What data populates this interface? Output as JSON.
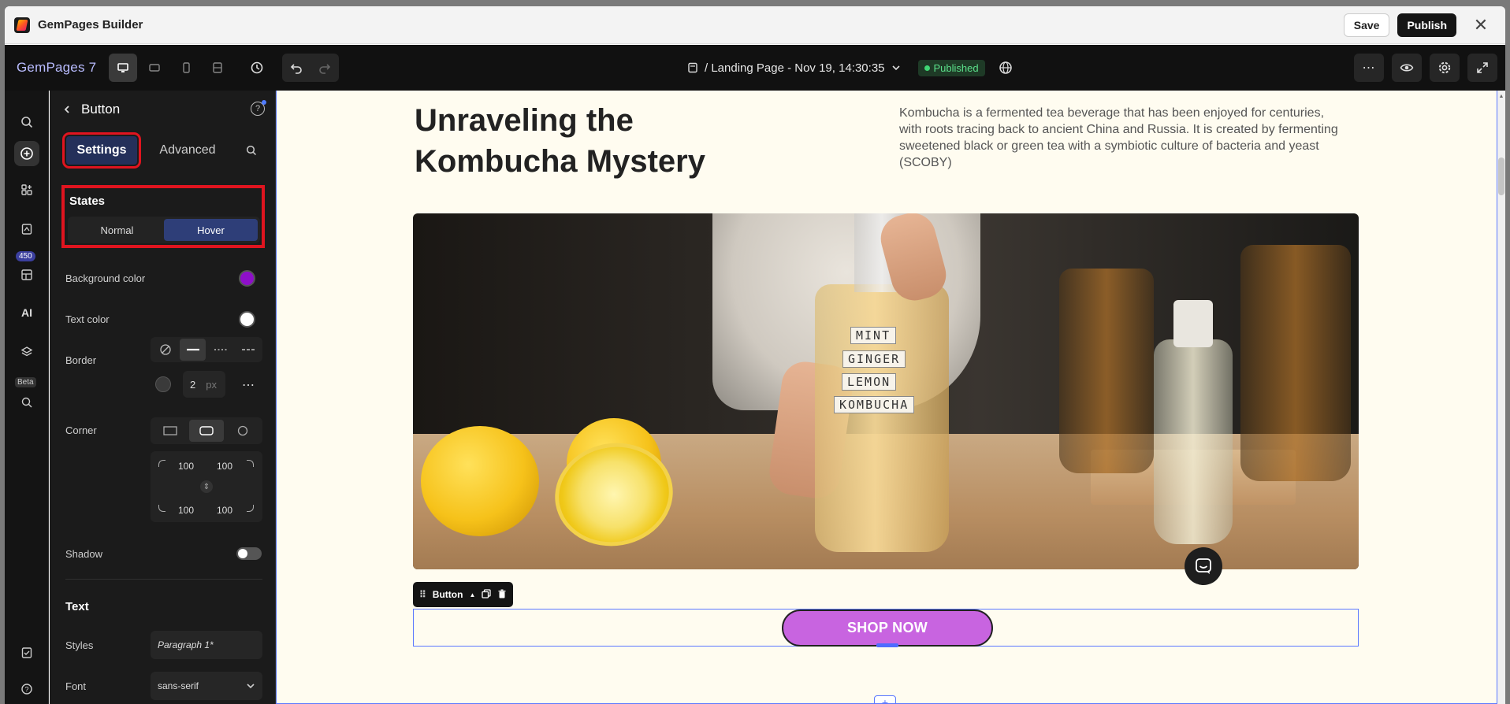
{
  "titlebar": {
    "app_name": "GemPages Builder",
    "save": "Save",
    "publish": "Publish"
  },
  "toolbar": {
    "brand": "GemPages 7",
    "page_name": "/ Landing Page - Nov 19, 14:30:35",
    "status": "Published"
  },
  "rail": {
    "badge": "450",
    "ai_label": "AI",
    "beta": "Beta"
  },
  "panel": {
    "title": "Button",
    "tabs": {
      "settings": "Settings",
      "advanced": "Advanced"
    },
    "states": {
      "title": "States",
      "normal": "Normal",
      "hover": "Hover"
    },
    "background_color_label": "Background color",
    "text_color_label": "Text color",
    "border_label": "Border",
    "border_width": "2",
    "border_unit": "px",
    "corner_label": "Corner",
    "corners": {
      "tl": "100",
      "tr": "100",
      "bl": "100",
      "br": "100"
    },
    "shadow_label": "Shadow",
    "text_section": "Text",
    "styles_label": "Styles",
    "styles_value": "Paragraph 1*",
    "font_label": "Font",
    "font_value": "sans-serif",
    "colors": {
      "background": "#8e0fc9",
      "text": "#ffffff"
    }
  },
  "canvas": {
    "heading": "Unraveling the Kombucha Mystery",
    "description": "Kombucha is a fermented tea beverage that has been enjoyed for centuries, with roots tracing back to ancient China and Russia. It is created by fermenting sweetened black or green tea with a symbiotic culture of bacteria and yeast (SCOBY)",
    "bottle_labels": [
      "MINT",
      "GINGER",
      "LEMON",
      "KOMBUCHA"
    ],
    "element_toolbar_label": "Button",
    "button_text": "SHOP NOW",
    "button_color": "#c864e0"
  }
}
